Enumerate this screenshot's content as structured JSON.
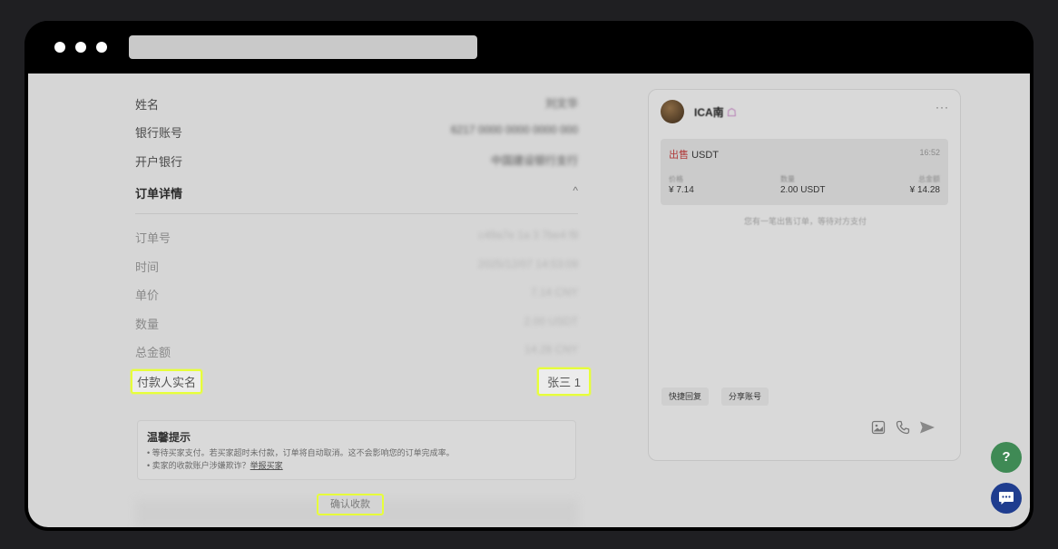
{
  "payment_info": {
    "name_label": "姓名",
    "name_value": "刘文华",
    "account_label": "银行账号",
    "account_value": "6217 0000 0000 0000 000",
    "bank_label": "开户银行",
    "bank_value": "中国建设银行支行"
  },
  "order_details": {
    "heading": "订单详情",
    "toggle": "^",
    "order_no_label": "订单号",
    "order_no_value": "c49a7e 1a 3 7be4 f9",
    "time_label": "时间",
    "time_value": "2025/12/07 14:53:09",
    "unit_price_label": "单价",
    "unit_price_value": "7.14 CNY",
    "quantity_label": "数量",
    "quantity_value": "2.00 USDT",
    "total_label": "总金额",
    "total_value": "14.28 CNY",
    "payer_label": "付款人实名",
    "payer_value": "张三 1"
  },
  "tips": {
    "title": "温馨提示",
    "tip1": "• 等待买家支付。若买家超时未付款，订单将自动取消。这不会影响您的订单完成率。",
    "tip2_prefix": "• 卖家的收款账户涉嫌欺诈？",
    "tip2_link": "举报买家"
  },
  "actions": {
    "confirm_label": "确认收款"
  },
  "chat": {
    "user_name": "ICA南",
    "badge": "☖",
    "more": "···",
    "order_card": {
      "side": "出售",
      "asset": "USDT",
      "time": "16:52",
      "price_label": "价格",
      "price_value": "¥ 7.14",
      "qty_label": "数量",
      "qty_value": "2.00 USDT",
      "total_label": "总金额",
      "total_value": "¥ 14.28"
    },
    "system_message": "您有一笔出售订单，等待对方支付",
    "quick_reply_label": "快捷回复",
    "share_account_label": "分享账号"
  },
  "fab": {
    "help_glyph": "?",
    "help_color": "#3f8a55",
    "chat_color": "#1f3d8f"
  },
  "colors": {
    "highlight_border": "#e7ff3a",
    "sell_red": "#b03a3a"
  }
}
